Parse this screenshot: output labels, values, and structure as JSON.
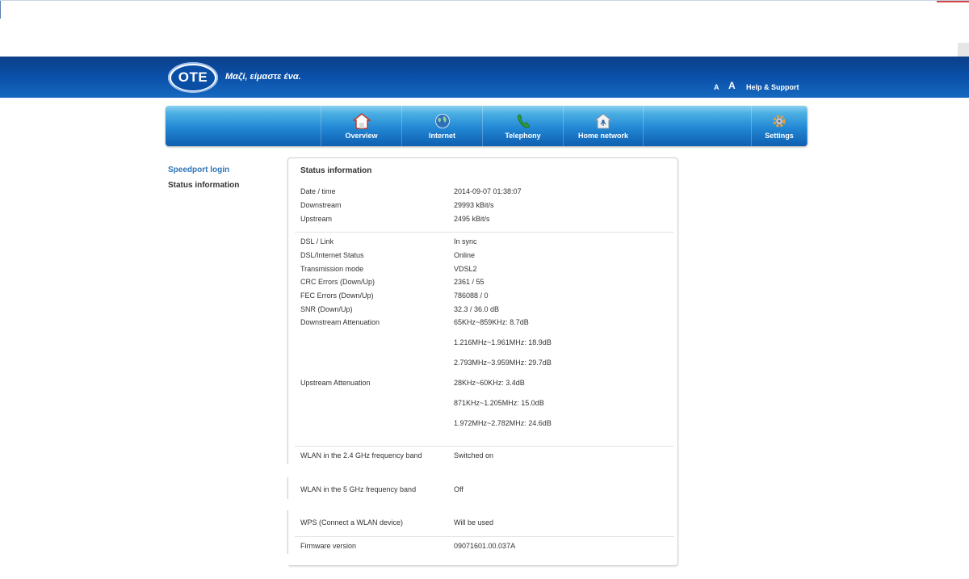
{
  "header": {
    "logo_text": "OTE",
    "slogan": "Μαζί, είμαστε ένα.",
    "font_small_label": "A",
    "font_large_label": "A",
    "help_label": "Help & Support",
    "brand_color": "#0a4ea6"
  },
  "nav": {
    "items": [
      {
        "label": "Overview",
        "icon": "house-icon"
      },
      {
        "label": "Internet",
        "icon": "globe-icon"
      },
      {
        "label": "Telephony",
        "icon": "phone-icon"
      },
      {
        "label": "Home network",
        "icon": "home-network-icon"
      },
      {
        "label": "Settings",
        "icon": "gear-icon"
      }
    ]
  },
  "sidebar": {
    "items": [
      {
        "label": "Speedport login",
        "active": true
      },
      {
        "label": "Status information",
        "active": false
      }
    ]
  },
  "panel": {
    "title": "Status information",
    "datetime": {
      "label": "Date / time",
      "value": "2014-09-07 01:38:07"
    },
    "downstream": {
      "label": "Downstream",
      "value": "29993 kBit/s"
    },
    "upstream": {
      "label": "Upstream",
      "value": "2495 kBit/s"
    },
    "dsl_link": {
      "label": "DSL / Link",
      "value": "In sync"
    },
    "dsl_status": {
      "label": "DSL/Internet Status",
      "value": "Online"
    },
    "transmission": {
      "label": "Transmission mode",
      "value": "VDSL2"
    },
    "crc": {
      "label": "CRC Errors (Down/Up)",
      "value": "2361 / 55"
    },
    "fec": {
      "label": "FEC Errors (Down/Up)",
      "value": "786088 / 0"
    },
    "snr": {
      "label": "SNR (Down/Up)",
      "value": "32.3 / 36.0 dB"
    },
    "down_att": {
      "label": "Downstream Attenuation",
      "values": [
        "65KHz~859KHz: 8.7dB",
        "1.216MHz~1.961MHz: 18.9dB",
        "2.793MHz~3.959MHz: 29.7dB"
      ]
    },
    "up_att": {
      "label": "Upstream Attenuation",
      "values": [
        "28KHz~60KHz: 3.4dB",
        "871KHz~1.205MHz: 15.0dB",
        "1.972MHz~2.782MHz: 24.6dB"
      ]
    },
    "wlan24": {
      "label": "WLAN in the 2.4 GHz frequency band",
      "value": "Switched on"
    },
    "wlan5": {
      "label": "WLAN in the 5 GHz frequency band",
      "value": "Off"
    },
    "wps": {
      "label": "WPS (Connect a WLAN device)",
      "value": "Will be used"
    },
    "firmware": {
      "label": "Firmware version",
      "value": "09071601.00.037A"
    }
  }
}
